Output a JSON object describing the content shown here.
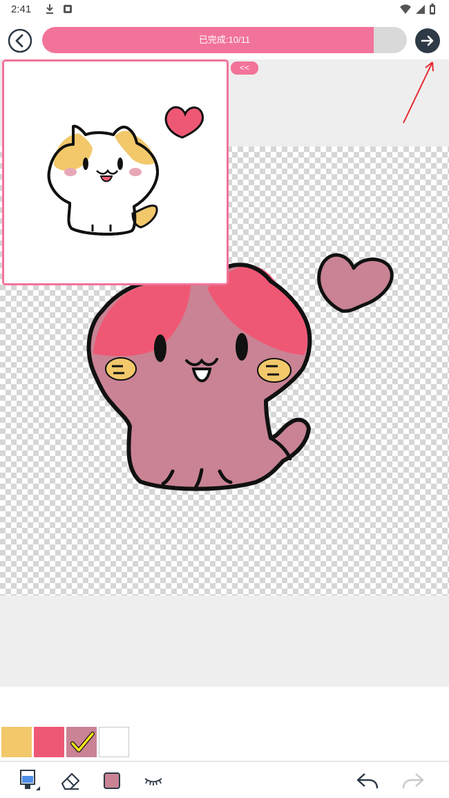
{
  "status_bar": {
    "time": "2:41",
    "icons": [
      "download-icon",
      "notification-icon",
      "wifi-icon",
      "signal-icon",
      "battery-icon"
    ]
  },
  "header": {
    "back_icon": "back-arrow-icon",
    "progress_label": "已完成:10/11",
    "progress_fraction": 0.909,
    "next_icon": "forward-arrow-icon"
  },
  "preview": {
    "collapse_label": "<<",
    "image": "reference-cat-with-heart"
  },
  "canvas": {
    "image": "cat-coloring-canvas"
  },
  "palette": {
    "colors": [
      "#f2c86b",
      "#ef5874",
      "#c98394",
      "#ffffff"
    ],
    "selected_index": 2
  },
  "toolbar": {
    "tools": [
      "paint-bucket-icon",
      "eraser-icon",
      "current-color-icon",
      "hide-eye-icon",
      "undo-icon",
      "redo-icon"
    ]
  },
  "colors": {
    "accent": "#f27399",
    "dark_button": "#2e3a46",
    "canvas_bg": "#eeeeee"
  }
}
